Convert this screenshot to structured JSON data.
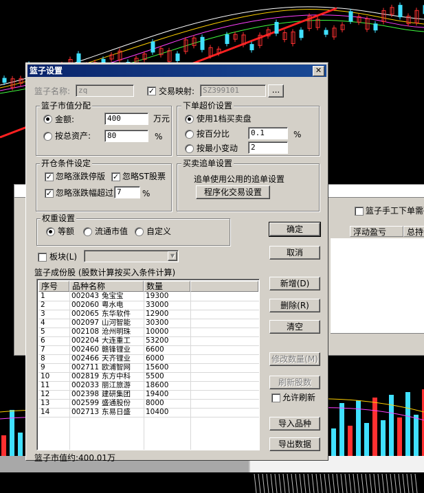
{
  "background_window": {
    "header_cells": [
      "浮动盈亏",
      "总持仓"
    ],
    "checkbox_label": "篮子手工下单需确"
  },
  "dialog": {
    "title": "篮子设置",
    "close_glyph": "✕",
    "basket_name_label": "篮子名称:",
    "basket_name_value": "zq",
    "trade_map_checked": true,
    "trade_map_label": "交易映射:",
    "trade_map_value": "SZ399101",
    "browse_label": "...",
    "market_value_group": {
      "title": "篮子市值分配",
      "amount_label": "金额:",
      "amount_value": "400",
      "amount_unit": "万元",
      "asset_label": "按总资产:",
      "asset_value": "80",
      "asset_unit": "%",
      "selected": "amount"
    },
    "overprice_group": {
      "title": "下单超价设置",
      "option1": "使用1档买卖盘",
      "option2": "按百分比",
      "option2_value": "0.1",
      "option2_unit": "%",
      "option3": "按最小变动",
      "option3_value": "2",
      "selected": "option1"
    },
    "open_cond_group": {
      "title": "开仓条件设定",
      "ignore_limit_up": "忽略涨跌停版",
      "ignore_st": "忽略ST股票",
      "ignore_change": "忽略涨跌幅超过",
      "ignore_change_value": "7",
      "ignore_change_unit": "%",
      "checked_limit_up": true,
      "checked_st": true,
      "checked_change": true
    },
    "chase_group": {
      "title": "买卖追单设置",
      "text": "追单使用公用的追单设置",
      "button": "程序化交易设置"
    },
    "weight_group": {
      "title": "权重设置",
      "opt_equal": "等额",
      "opt_float": "流通市值",
      "opt_custom": "自定义",
      "selected": "equal"
    },
    "sector_checked": false,
    "sector_label": "板块(L)",
    "components_label": "篮子成份股 (股数计算按买入条件计算)",
    "columns": [
      "序号",
      "品种名称",
      "数量"
    ],
    "rows": [
      {
        "no": "1",
        "code": "002043",
        "name": "兔宝宝",
        "qty": "19300"
      },
      {
        "no": "2",
        "code": "002060",
        "name": "粤水电",
        "qty": "33000"
      },
      {
        "no": "3",
        "code": "002065",
        "name": "东华软件",
        "qty": "12900"
      },
      {
        "no": "4",
        "code": "002097",
        "name": "山河智能",
        "qty": "30300"
      },
      {
        "no": "5",
        "code": "002108",
        "name": "沧州明珠",
        "qty": "10000"
      },
      {
        "no": "6",
        "code": "002204",
        "name": "大连重工",
        "qty": "53200"
      },
      {
        "no": "7",
        "code": "002460",
        "name": "赣锋锂业",
        "qty": "6600"
      },
      {
        "no": "8",
        "code": "002466",
        "name": "天齐锂业",
        "qty": "6000"
      },
      {
        "no": "9",
        "code": "002711",
        "name": "欧浦智网",
        "qty": "15600"
      },
      {
        "no": "10",
        "code": "002819",
        "name": "东方中科",
        "qty": "5500"
      },
      {
        "no": "11",
        "code": "002033",
        "name": "丽江旅游",
        "qty": "18600"
      },
      {
        "no": "12",
        "code": "002398",
        "name": "建研集团",
        "qty": "19400"
      },
      {
        "no": "13",
        "code": "002599",
        "name": "盛通股份",
        "qty": "8000"
      },
      {
        "no": "14",
        "code": "002713",
        "name": "东易日盛",
        "qty": "10400"
      }
    ],
    "buttons": {
      "ok": "确定",
      "cancel": "取消",
      "add": "新增(D)",
      "delete": "删除(R)",
      "clear": "清空",
      "modify_qty": "修改数量(M)",
      "refresh": "刷新股数",
      "import": "导入品种",
      "export": "导出数据"
    },
    "allow_refresh_label": "允许刷新",
    "allow_refresh_checked": false,
    "total_value_label": "篮子市值约:400.01万"
  },
  "colors": {
    "dialog_face": "#d4d0c8",
    "titlebar": "#0a246a",
    "chart_bg": "#000000",
    "trend_line": "#ff2020",
    "bar_cyan": "#40e0ff",
    "bar_red": "#ff3030"
  }
}
